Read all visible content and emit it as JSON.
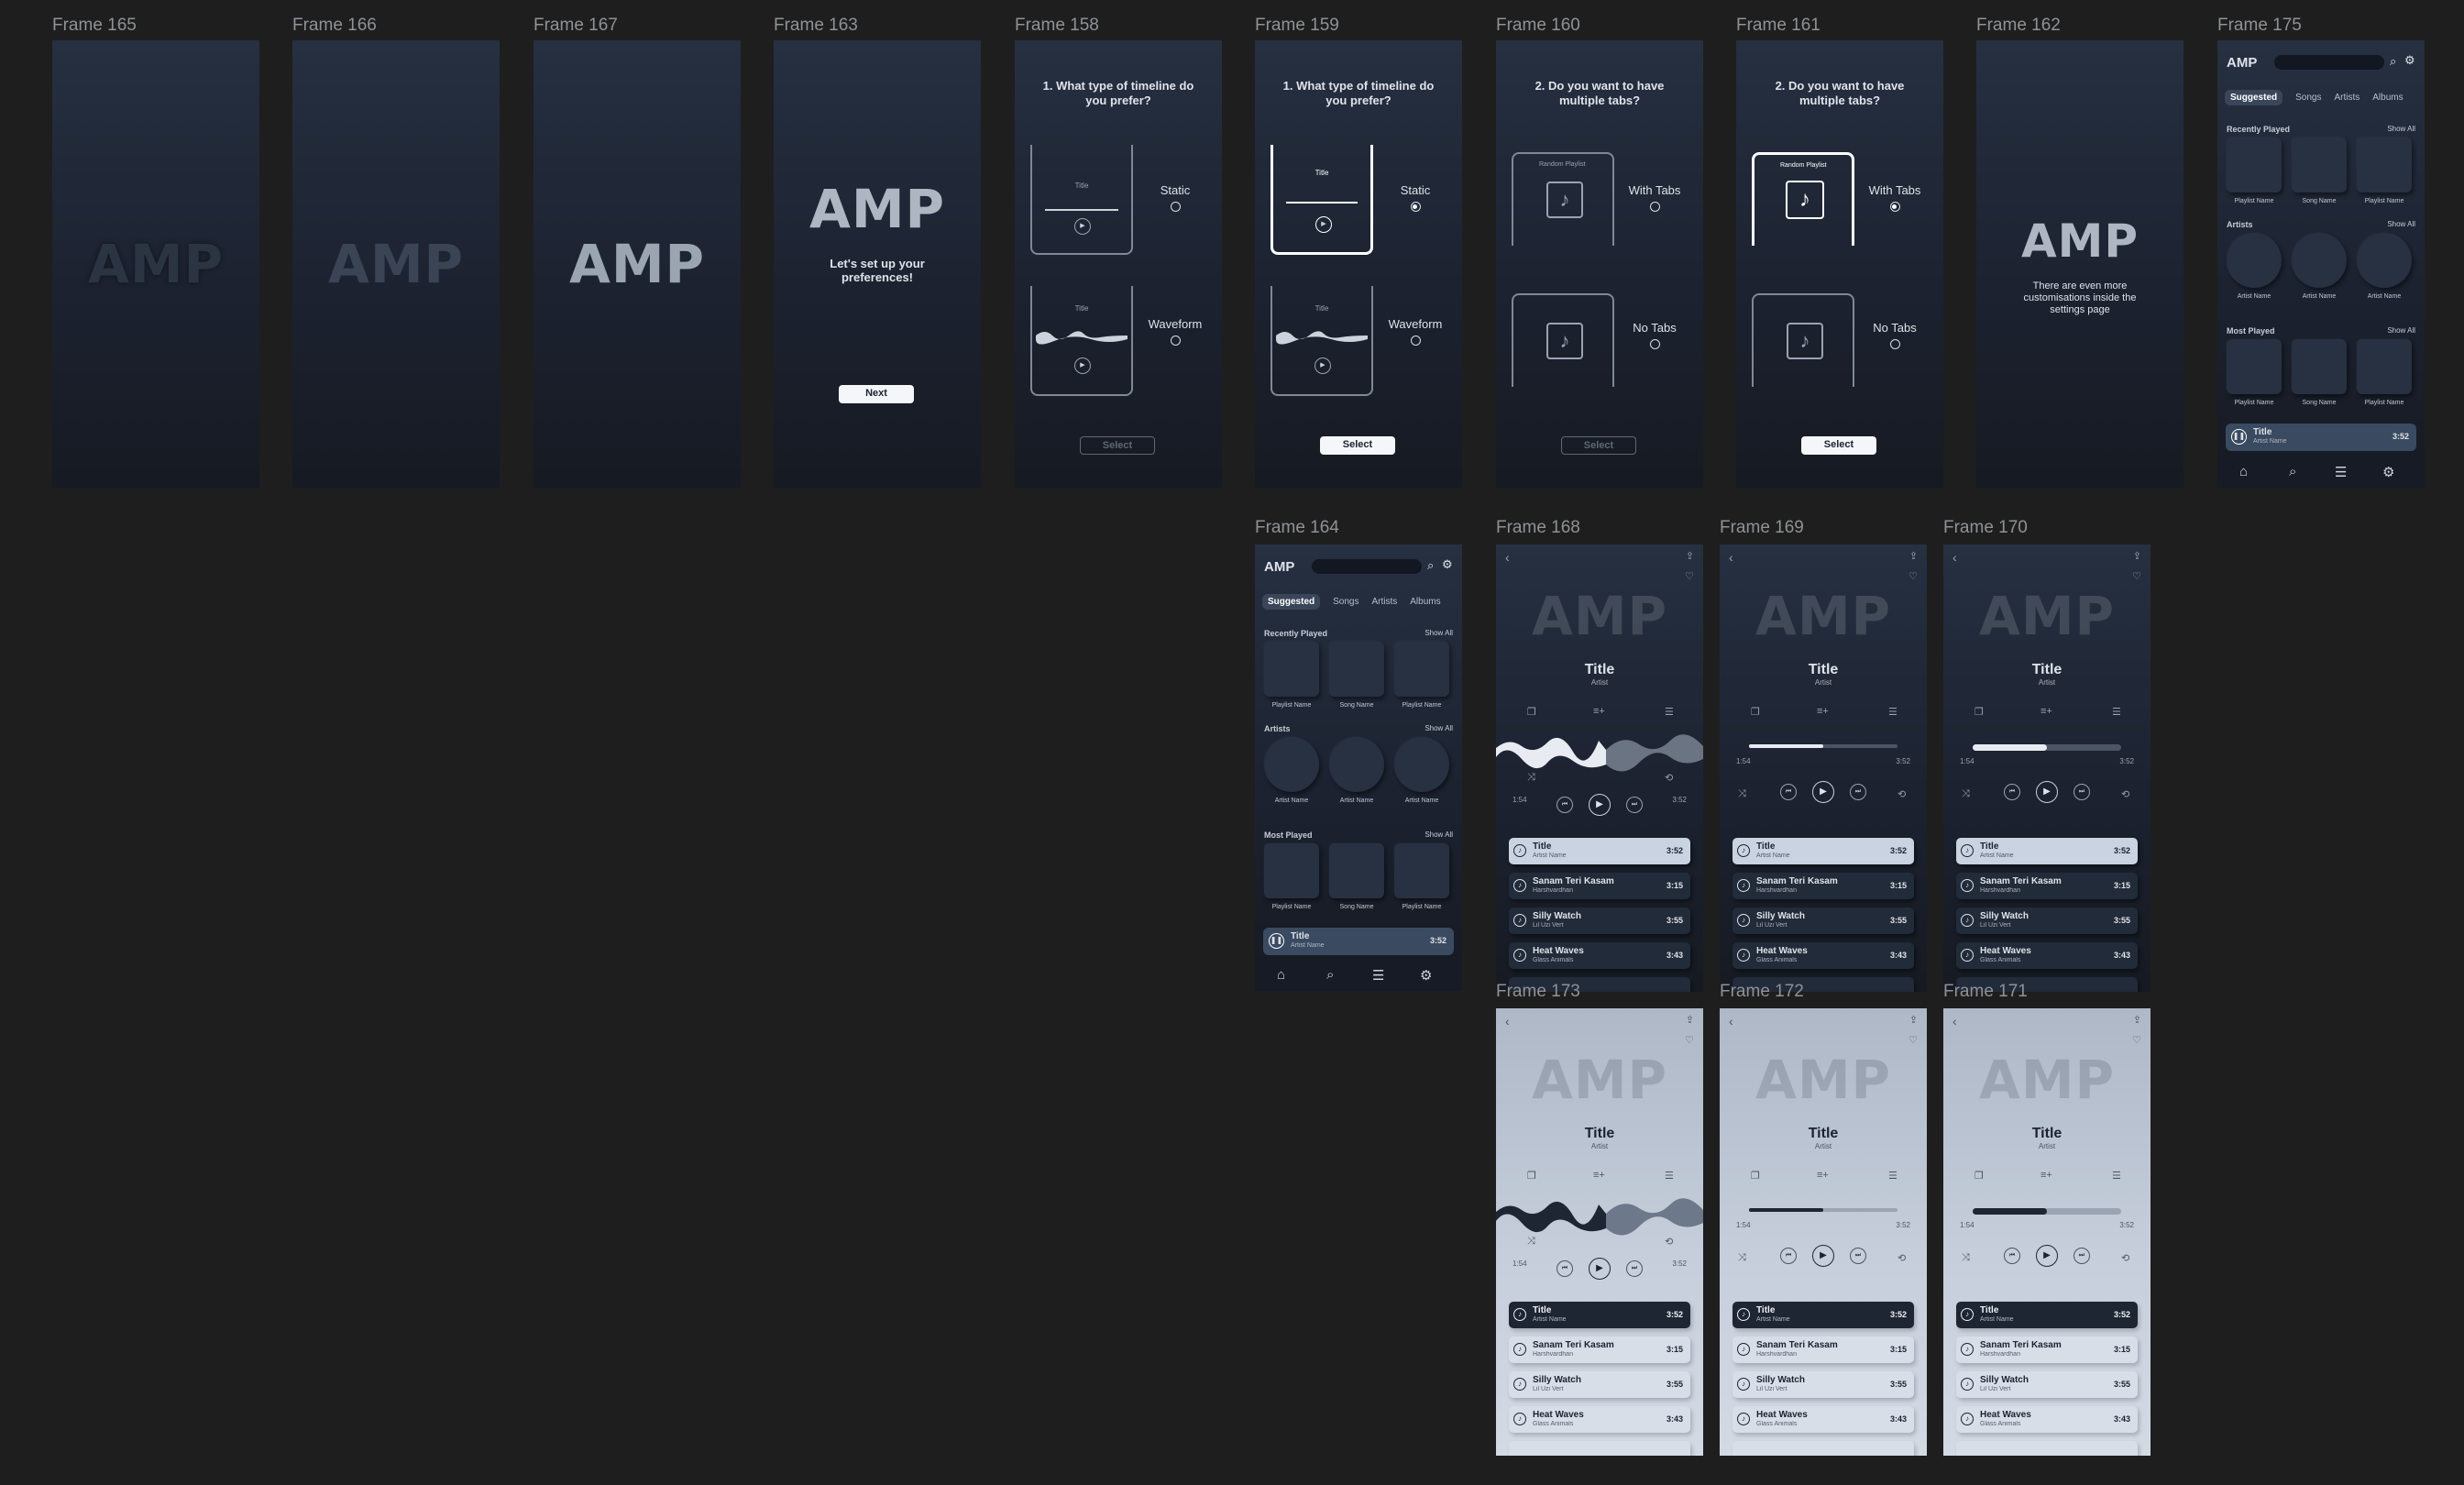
{
  "frame_labels": {
    "f165": "Frame 165",
    "f166": "Frame 166",
    "f167": "Frame 167",
    "f163": "Frame 163",
    "f158": "Frame 158",
    "f159": "Frame 159",
    "f160": "Frame 160",
    "f161": "Frame 161",
    "f162": "Frame 162",
    "f175": "Frame 175",
    "f164": "Frame 164",
    "f168": "Frame 168",
    "f169": "Frame 169",
    "f170": "Frame 170",
    "f173": "Frame 173",
    "f172": "Frame 172",
    "f171": "Frame 171"
  },
  "brand": {
    "logo": "AMP",
    "accent": "#c9d3e2",
    "dark_bg": "#1c2230",
    "light_bg": "#c6cedb"
  },
  "onboarding": {
    "setup_text": "Let's set up your preferences!",
    "next": "Next",
    "q1": "1. What type of timeline do you prefer?",
    "q2": "2. Do you want to have multiple tabs?",
    "static": "Static",
    "waveform": "Waveform",
    "with_tabs": "With Tabs",
    "no_tabs": "No Tabs",
    "select": "Select",
    "preview_title": "Title",
    "preview_playlist": "Random Playlist",
    "final_text": "There are even more customisations inside the settings page"
  },
  "home": {
    "logo": "AMP",
    "tabs": [
      "Suggested",
      "Songs",
      "Artists",
      "Albums"
    ],
    "recently_played": "Recently Played",
    "artists": "Artists",
    "most_played": "Most Played",
    "show_all": "Show All",
    "recent_caps": [
      "Playlist Name",
      "Song Name",
      "Playlist Name"
    ],
    "artist_caps": [
      "Artist Name",
      "Artist Name",
      "Artist Name"
    ],
    "most_caps": [
      "Playlist Name",
      "Song Name",
      "Playlist Name"
    ],
    "now_playing": {
      "title": "Title",
      "artist": "Artist Name",
      "duration": "3:52"
    },
    "icons": [
      "home-icon",
      "search-icon",
      "queue-icon",
      "settings-icon"
    ]
  },
  "player": {
    "logo": "AMP",
    "title": "Title",
    "artist": "Artist",
    "elapsed": "1:54",
    "total": "3:52",
    "tracks": [
      {
        "title": "Title",
        "artist": "Artist Name",
        "duration": "3:52"
      },
      {
        "title": "Sanam Teri Kasam",
        "artist": "Harshvardhan",
        "duration": "3:15"
      },
      {
        "title": "Silly Watch",
        "artist": "Lil Uzi Vert",
        "duration": "3:55"
      },
      {
        "title": "Heat Waves",
        "artist": "Glass Animals",
        "duration": "3:43"
      }
    ],
    "progress": 0.5
  }
}
